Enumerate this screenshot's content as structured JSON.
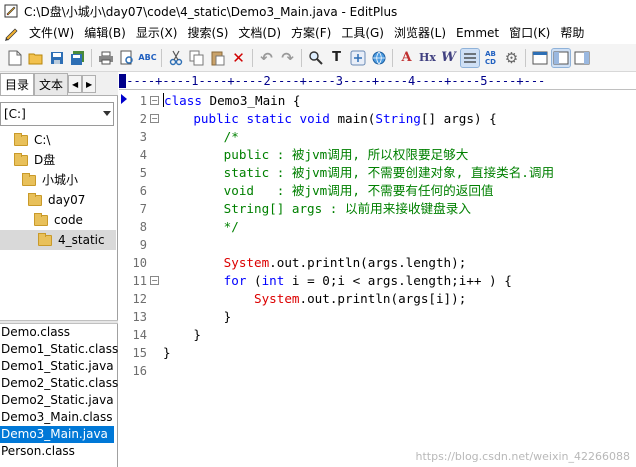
{
  "window": {
    "title": "C:\\D盘\\小城小\\day07\\code\\4_static\\Demo3_Main.java - EditPlus"
  },
  "menu": [
    "文件(W)",
    "编辑(B)",
    "显示(X)",
    "搜索(S)",
    "文档(D)",
    "方案(F)",
    "工具(G)",
    "浏览器(L)",
    "Emmet",
    "窗口(K)",
    "帮助"
  ],
  "toolbar": {
    "icons": [
      "new-file-icon",
      "open-icon",
      "save-icon",
      "save-all-icon",
      "print-icon",
      "print-preview-icon",
      "spell-check-icon",
      "cut-icon",
      "copy-icon",
      "paste-icon",
      "delete-icon",
      "undo-icon",
      "redo-icon",
      "find-icon",
      "font-icon",
      "html-toolbar-icon",
      "browser-icon",
      "heading-font-icon",
      "hx-icon",
      "word-wrap-icon",
      "line-number-icon",
      "column-ruler-icon",
      "settings-icon",
      "screen-icon",
      "cliptext-icon",
      "directory-icon"
    ]
  },
  "left_panel": {
    "tabs": [
      "目录",
      "文本"
    ],
    "drive": "[C:]",
    "tree": [
      "C:\\",
      "D盘",
      "小城小",
      "day07",
      "code",
      "4_static"
    ],
    "files": [
      "Demo.class",
      "Demo1_Static.class",
      "Demo1_Static.java",
      "Demo2_Static.class",
      "Demo2_Static.java",
      "Demo3_Main.class",
      "Demo3_Main.java",
      "Person.class"
    ],
    "selected_file": "Demo3_Main.java"
  },
  "editor": {
    "ruler": "----+----1----+----2----+----3----+----4----+----5----+---",
    "line_numbers": [
      "1",
      "2",
      "3",
      "4",
      "5",
      "6",
      "7",
      "8",
      "9",
      "10",
      "11",
      "12",
      "13",
      "14",
      "15",
      "16"
    ],
    "lines": [
      "class Demo3_Main {",
      "    public static void main(String[] args) {",
      "        /*",
      "        public : 被jvm调用, 所以权限要足够大",
      "        static : 被jvm调用, 不需要创建对象, 直接类名.调用",
      "        void   : 被jvm调用, 不需要有任何的返回值",
      "        String[] args : 以前用来接收键盘录入",
      "        */",
      "",
      "        System.out.println(args.length);",
      "        for (int i = 0;i < args.length;i++ ) {",
      "            System.out.println(args[i]);",
      "        }",
      "    }",
      "}",
      ""
    ]
  },
  "watermark": "https://blog.csdn.net/weixin_42266088",
  "colors": {
    "keyword": "#0000ff",
    "comment": "#008000",
    "system": "#dc0000",
    "selection": "#0078d7"
  }
}
